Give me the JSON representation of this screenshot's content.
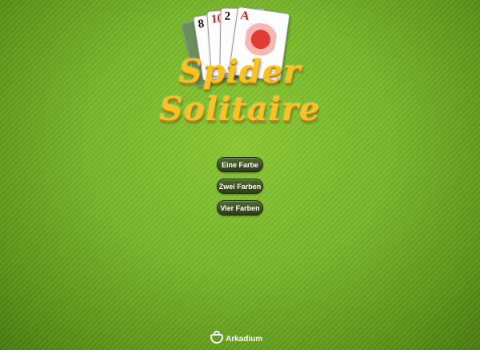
{
  "logo": {
    "title": "Spider Solitaire",
    "cards": [
      "8",
      "10",
      "2",
      "A"
    ]
  },
  "menu": {
    "one_suit": "Eine Farbe",
    "two_suits": "Zwei Farben",
    "four_suits": "Vier Farben"
  },
  "footer": {
    "brand": "Arkadium"
  },
  "colors": {
    "background": "#78b62a",
    "button": "#3a5020",
    "title": "#f7c224"
  }
}
